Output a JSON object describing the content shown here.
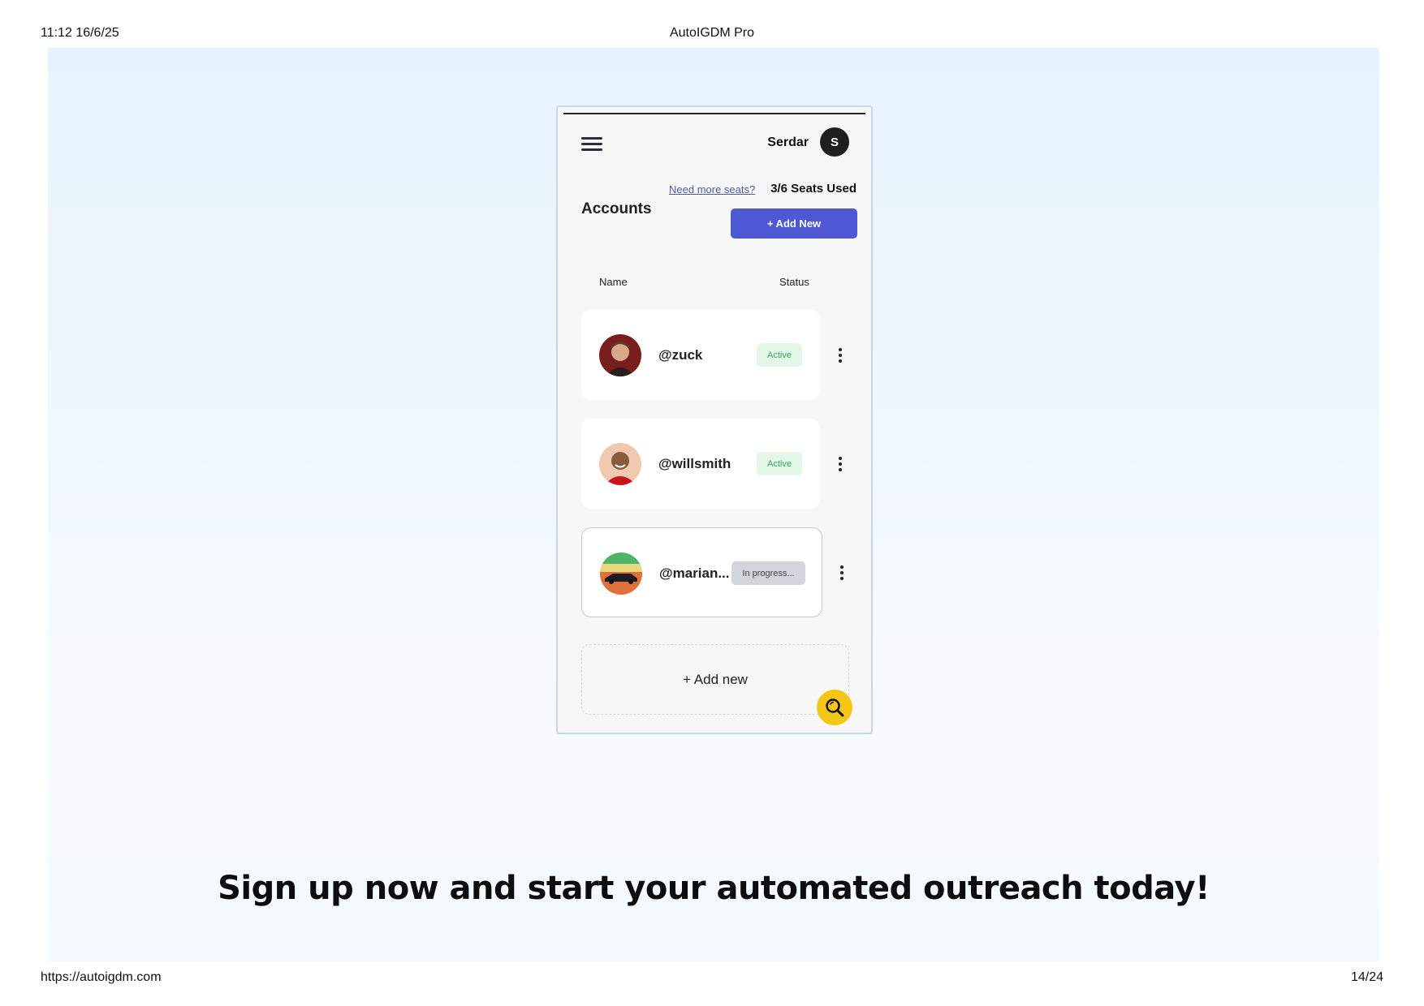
{
  "print": {
    "datetime": "11:12 16/6/25",
    "title": "AutoIGDM Pro",
    "url": "https://autoigdm.com",
    "page": "14/24"
  },
  "header": {
    "user_name": "Serdar",
    "avatar_initial": "S"
  },
  "accounts": {
    "seats_link": "Need more seats?",
    "seats_used": "3/6 Seats Used",
    "title": "Accounts",
    "add_button": "+ Add New",
    "columns": {
      "name": "Name",
      "status": "Status"
    },
    "items": [
      {
        "handle": "@zuck",
        "status": "Active"
      },
      {
        "handle": "@willsmith",
        "status": "Active"
      },
      {
        "handle": "@marian...",
        "status": "In progress..."
      }
    ],
    "add_new_box": "+ Add new"
  },
  "cta": "Sign up now and start your automated outreach today!",
  "colors": {
    "accent": "#4e57d4",
    "active_bg": "#e4f7ea",
    "active_text": "#2dab58",
    "fab": "#f5c518"
  }
}
